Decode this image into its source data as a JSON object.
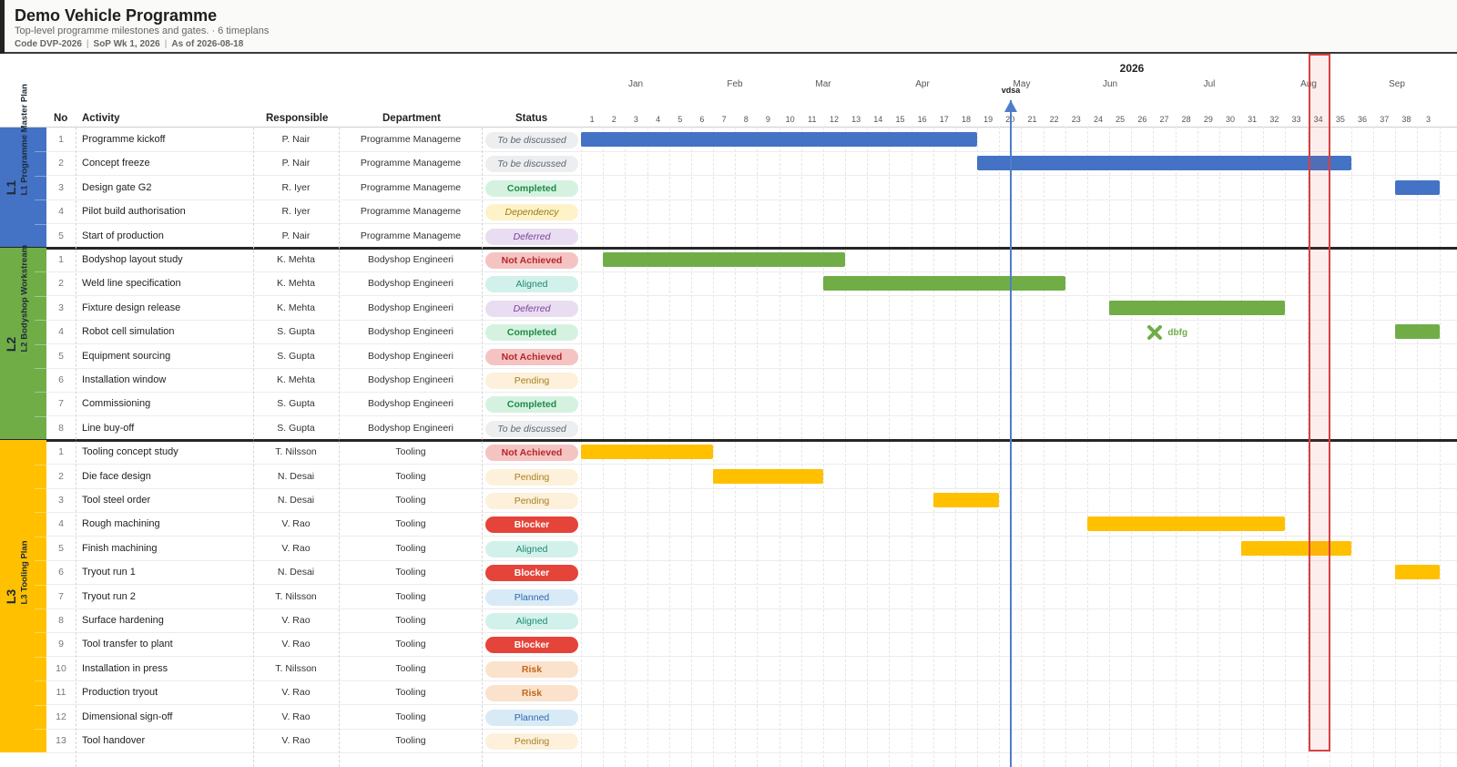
{
  "header": {
    "title": "Demo Vehicle Programme",
    "subtitle": "Top-level programme milestones and gates. · 6 timeplans",
    "code": "Code DVP-2026",
    "sop": "SoP Wk 1, 2026",
    "as_of": "As of 2026-08-18",
    "separator": "|"
  },
  "columns": {
    "no": "No",
    "activity": "Activity",
    "responsible": "Responsible",
    "department": "Department",
    "status": "Status"
  },
  "timeline": {
    "year": "2026",
    "months": [
      "Jan",
      "Feb",
      "Mar",
      "Apr",
      "May",
      "Jun",
      "Jul",
      "Aug",
      "Sep"
    ],
    "weeks": [
      "1",
      "2",
      "3",
      "4",
      "5",
      "6",
      "7",
      "8",
      "9",
      "10",
      "11",
      "12",
      "13",
      "14",
      "15",
      "16",
      "17",
      "18",
      "19",
      "20",
      "21",
      "22",
      "23",
      "24",
      "25",
      "26",
      "27",
      "28",
      "29",
      "30",
      "31",
      "32",
      "33",
      "34",
      "35",
      "36",
      "37",
      "38",
      "3"
    ],
    "today_label": "vdsa",
    "today_week": 20,
    "highlighted_week": 34
  },
  "groups": [
    {
      "code": "L1",
      "name": "L1 Programme Master Plan",
      "color": "#4472c4",
      "rows": [
        {
          "no": "1",
          "activity": "Programme kickoff",
          "responsible": "P. Nair",
          "department": "Programme Manageme",
          "status": "To be discussed",
          "status_class": "s-tbd",
          "bars": [
            [
              1,
              19
            ]
          ]
        },
        {
          "no": "2",
          "activity": "Concept freeze",
          "responsible": "P. Nair",
          "department": "Programme Manageme",
          "status": "To be discussed",
          "status_class": "s-tbd",
          "bars": [
            [
              19,
              36
            ]
          ]
        },
        {
          "no": "3",
          "activity": "Design gate G2",
          "responsible": "R. Iyer",
          "department": "Programme Manageme",
          "status": "Completed",
          "status_class": "s-completed",
          "bars": [
            [
              38,
              40
            ]
          ]
        },
        {
          "no": "4",
          "activity": "Pilot build authorisation",
          "responsible": "R. Iyer",
          "department": "Programme Manageme",
          "status": "Dependency",
          "status_class": "s-dependency",
          "bars": []
        },
        {
          "no": "5",
          "activity": "Start of production",
          "responsible": "P. Nair",
          "department": "Programme Manageme",
          "status": "Deferred",
          "status_class": "s-deferred",
          "bars": []
        }
      ]
    },
    {
      "code": "L2",
      "name": "L2 Bodyshop Workstream",
      "color": "#70ad47",
      "rows": [
        {
          "no": "1",
          "activity": "Bodyshop layout study",
          "responsible": "K. Mehta",
          "department": "Bodyshop Engineeri",
          "status": "Not Achieved",
          "status_class": "s-notach",
          "bars": [
            [
              2,
              13
            ]
          ]
        },
        {
          "no": "2",
          "activity": "Weld line specification",
          "responsible": "K. Mehta",
          "department": "Bodyshop Engineeri",
          "status": "Aligned",
          "status_class": "s-aligned",
          "bars": [
            [
              12,
              23
            ]
          ]
        },
        {
          "no": "3",
          "activity": "Fixture design release",
          "responsible": "K. Mehta",
          "department": "Bodyshop Engineeri",
          "status": "Deferred",
          "status_class": "s-deferred",
          "bars": [
            [
              25,
              33
            ]
          ]
        },
        {
          "no": "4",
          "activity": "Robot cell simulation",
          "responsible": "S. Gupta",
          "department": "Bodyshop Engineeri",
          "status": "Completed",
          "status_class": "s-completed",
          "bars": [
            [
              38,
              40
            ]
          ],
          "milestone": {
            "week": 27,
            "label": "dbfg"
          }
        },
        {
          "no": "5",
          "activity": "Equipment sourcing",
          "responsible": "S. Gupta",
          "department": "Bodyshop Engineeri",
          "status": "Not Achieved",
          "status_class": "s-notach",
          "bars": []
        },
        {
          "no": "6",
          "activity": "Installation window",
          "responsible": "K. Mehta",
          "department": "Bodyshop Engineeri",
          "status": "Pending",
          "status_class": "s-pending",
          "bars": []
        },
        {
          "no": "7",
          "activity": "Commissioning",
          "responsible": "S. Gupta",
          "department": "Bodyshop Engineeri",
          "status": "Completed",
          "status_class": "s-completed",
          "bars": []
        },
        {
          "no": "8",
          "activity": "Line buy-off",
          "responsible": "S. Gupta",
          "department": "Bodyshop Engineeri",
          "status": "To be discussed",
          "status_class": "s-tbd",
          "bars": []
        }
      ]
    },
    {
      "code": "L3",
      "name": "L3 Tooling Plan",
      "color": "#ffc000",
      "rows": [
        {
          "no": "1",
          "activity": "Tooling concept study",
          "responsible": "T. Nilsson",
          "department": "Tooling",
          "status": "Not Achieved",
          "status_class": "s-notach",
          "bars": [
            [
              1,
              7
            ]
          ]
        },
        {
          "no": "2",
          "activity": "Die face design",
          "responsible": "N. Desai",
          "department": "Tooling",
          "status": "Pending",
          "status_class": "s-pending",
          "bars": [
            [
              7,
              12
            ]
          ]
        },
        {
          "no": "3",
          "activity": "Tool steel order",
          "responsible": "N. Desai",
          "department": "Tooling",
          "status": "Pending",
          "status_class": "s-pending",
          "bars": [
            [
              17,
              20
            ]
          ]
        },
        {
          "no": "4",
          "activity": "Rough machining",
          "responsible": "V. Rao",
          "department": "Tooling",
          "status": "Blocker",
          "status_class": "s-blocker",
          "bars": [
            [
              24,
              33
            ]
          ]
        },
        {
          "no": "5",
          "activity": "Finish machining",
          "responsible": "V. Rao",
          "department": "Tooling",
          "status": "Aligned",
          "status_class": "s-aligned",
          "bars": [
            [
              31,
              36
            ]
          ]
        },
        {
          "no": "6",
          "activity": "Tryout run 1",
          "responsible": "N. Desai",
          "department": "Tooling",
          "status": "Blocker",
          "status_class": "s-blocker",
          "bars": [
            [
              38,
              40
            ]
          ]
        },
        {
          "no": "7",
          "activity": "Tryout run 2",
          "responsible": "T. Nilsson",
          "department": "Tooling",
          "status": "Planned",
          "status_class": "s-planned",
          "bars": []
        },
        {
          "no": "8",
          "activity": "Surface hardening",
          "responsible": "V. Rao",
          "department": "Tooling",
          "status": "Aligned",
          "status_class": "s-aligned",
          "bars": []
        },
        {
          "no": "9",
          "activity": "Tool transfer to plant",
          "responsible": "V. Rao",
          "department": "Tooling",
          "status": "Blocker",
          "status_class": "s-blocker",
          "bars": []
        },
        {
          "no": "10",
          "activity": "Installation in press",
          "responsible": "T. Nilsson",
          "department": "Tooling",
          "status": "Risk",
          "status_class": "s-risk",
          "bars": []
        },
        {
          "no": "11",
          "activity": "Production tryout",
          "responsible": "V. Rao",
          "department": "Tooling",
          "status": "Risk",
          "status_class": "s-risk",
          "bars": []
        },
        {
          "no": "12",
          "activity": "Dimensional sign-off",
          "responsible": "V. Rao",
          "department": "Tooling",
          "status": "Planned",
          "status_class": "s-planned",
          "bars": []
        },
        {
          "no": "13",
          "activity": "Tool handover",
          "responsible": "V. Rao",
          "department": "Tooling",
          "status": "Pending",
          "status_class": "s-pending",
          "bars": []
        }
      ]
    }
  ]
}
